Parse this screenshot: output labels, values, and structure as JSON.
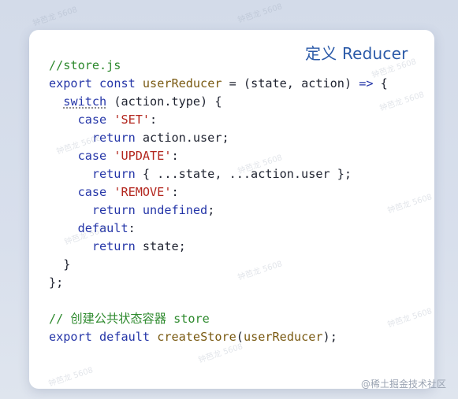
{
  "card": {
    "title": "定义 Reducer"
  },
  "code": {
    "lines": [
      [
        {
          "t": "//store.js",
          "c": "cmt"
        }
      ],
      [
        {
          "t": "export",
          "c": "kw"
        },
        {
          "t": " ",
          "c": "op"
        },
        {
          "t": "const",
          "c": "kw"
        },
        {
          "t": " ",
          "c": "op"
        },
        {
          "t": "userReducer",
          "c": "fn"
        },
        {
          "t": " = (state, action) ",
          "c": "var"
        },
        {
          "t": "=>",
          "c": "kw"
        },
        {
          "t": " {",
          "c": "var"
        }
      ],
      [
        {
          "t": "  ",
          "c": "op"
        },
        {
          "t": "switch",
          "c": "kw sw"
        },
        {
          "t": " (action.type) {",
          "c": "var"
        }
      ],
      [
        {
          "t": "    ",
          "c": "op"
        },
        {
          "t": "case",
          "c": "kw"
        },
        {
          "t": " ",
          "c": "op"
        },
        {
          "t": "'SET'",
          "c": "str"
        },
        {
          "t": ":",
          "c": "var"
        }
      ],
      [
        {
          "t": "      ",
          "c": "op"
        },
        {
          "t": "return",
          "c": "kw"
        },
        {
          "t": " action.user;",
          "c": "var"
        }
      ],
      [
        {
          "t": "    ",
          "c": "op"
        },
        {
          "t": "case",
          "c": "kw"
        },
        {
          "t": " ",
          "c": "op"
        },
        {
          "t": "'UPDATE'",
          "c": "str"
        },
        {
          "t": ":",
          "c": "var"
        }
      ],
      [
        {
          "t": "      ",
          "c": "op"
        },
        {
          "t": "return",
          "c": "kw"
        },
        {
          "t": " { ...state, ...action.user };",
          "c": "var"
        }
      ],
      [
        {
          "t": "    ",
          "c": "op"
        },
        {
          "t": "case",
          "c": "kw"
        },
        {
          "t": " ",
          "c": "op"
        },
        {
          "t": "'REMOVE'",
          "c": "str"
        },
        {
          "t": ":",
          "c": "var"
        }
      ],
      [
        {
          "t": "      ",
          "c": "op"
        },
        {
          "t": "return",
          "c": "kw"
        },
        {
          "t": " ",
          "c": "op"
        },
        {
          "t": "undefined",
          "c": "kw"
        },
        {
          "t": ";",
          "c": "var"
        }
      ],
      [
        {
          "t": "    ",
          "c": "op"
        },
        {
          "t": "default",
          "c": "kw"
        },
        {
          "t": ":",
          "c": "var"
        }
      ],
      [
        {
          "t": "      ",
          "c": "op"
        },
        {
          "t": "return",
          "c": "kw"
        },
        {
          "t": " state;",
          "c": "var"
        }
      ],
      [
        {
          "t": "  }",
          "c": "var"
        }
      ],
      [
        {
          "t": "};",
          "c": "var"
        }
      ],
      [
        {
          "t": "",
          "c": "var"
        }
      ],
      [
        {
          "t": "// 创建公共状态容器 store",
          "c": "cmt"
        }
      ],
      [
        {
          "t": "export",
          "c": "kw"
        },
        {
          "t": " ",
          "c": "op"
        },
        {
          "t": "default",
          "c": "kw"
        },
        {
          "t": " ",
          "c": "op"
        },
        {
          "t": "createStore",
          "c": "fn"
        },
        {
          "t": "(",
          "c": "var"
        },
        {
          "t": "userReducer",
          "c": "fn"
        },
        {
          "t": ");",
          "c": "var"
        }
      ]
    ]
  },
  "watermark": {
    "text": "@稀土掘金技术社区",
    "faint_text": "钟芭龙 5608"
  }
}
